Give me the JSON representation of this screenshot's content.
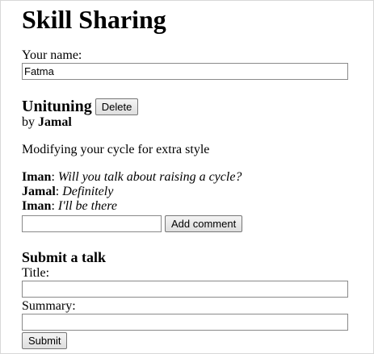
{
  "page": {
    "title": "Skill Sharing"
  },
  "user": {
    "name_label": "Your name:",
    "name_value": "Fatma"
  },
  "talk": {
    "title": "Unituning",
    "delete_label": "Delete",
    "by_prefix": "by",
    "presenter": "Jamal",
    "summary": "Modifying your cycle for extra style",
    "comments": [
      {
        "author": "Iman",
        "separator": ": ",
        "message": "Will you talk about raising a cycle?"
      },
      {
        "author": "Jamal",
        "separator": ": ",
        "message": "Definitely"
      },
      {
        "author": "Iman",
        "separator": ": ",
        "message": "I'll be there"
      }
    ],
    "comment_input_value": "",
    "add_comment_label": "Add comment"
  },
  "submit_form": {
    "heading": "Submit a talk",
    "title_label": "Title:",
    "title_value": "",
    "summary_label": "Summary:",
    "summary_value": "",
    "submit_label": "Submit"
  }
}
